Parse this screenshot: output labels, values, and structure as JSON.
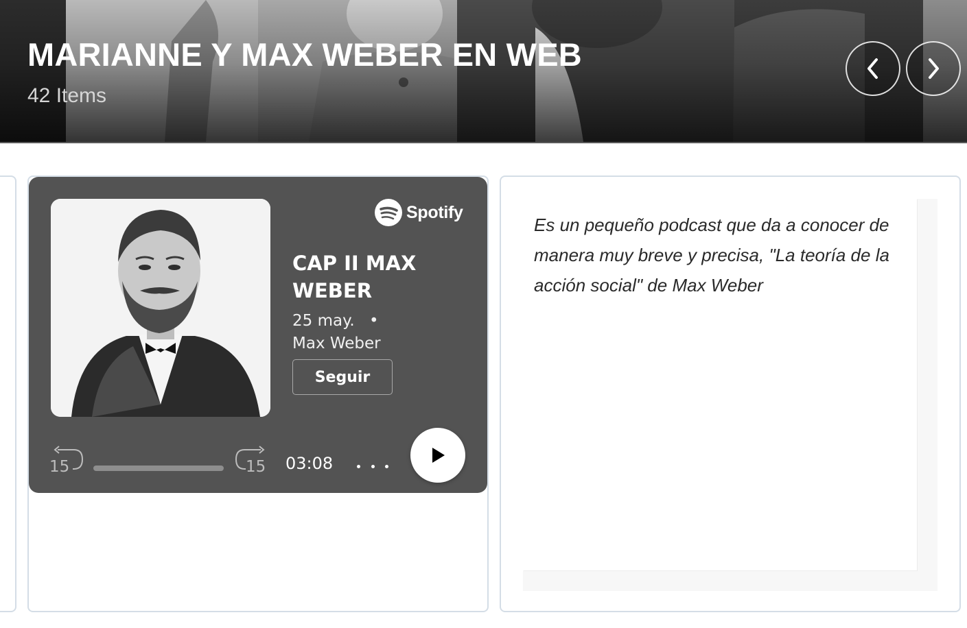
{
  "collection": {
    "title": "MARIANNE Y MAX WEBER EN WEB",
    "count": "42 Items"
  },
  "player": {
    "brand": "Spotify",
    "episode_title": "CAP II MAX WEBER",
    "date": "25 may.",
    "separator": "•",
    "author": "Max Weber",
    "follow_label": "Seguir",
    "skip_back": "15",
    "skip_forward": "15",
    "time_remaining": "03:08",
    "progress": 0
  },
  "description": {
    "text": "Es un pequeño podcast que da a conocer de manera muy breve y precisa, \"La teoría de la acción social\" de Max Weber"
  },
  "icons": {
    "prev": "chevron-left-icon",
    "next": "chevron-right-icon",
    "spotify": "spotify-logo-icon",
    "play": "play-icon",
    "more": "more-dots-icon"
  },
  "colors": {
    "embed_bg": "#535353",
    "card_border": "#d4dde6",
    "title": "#ffffff"
  }
}
